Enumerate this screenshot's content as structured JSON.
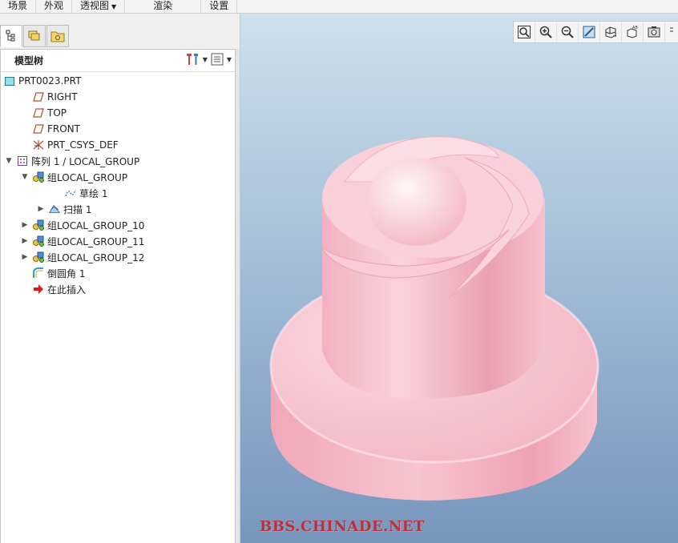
{
  "ribbon": {
    "tabs": [
      {
        "label": "场景",
        "dropdown": false
      },
      {
        "label": "外观",
        "dropdown": false
      },
      {
        "label": "透视图",
        "dropdown": true
      },
      {
        "label": "渲染",
        "dropdown": false
      },
      {
        "label": "设置",
        "dropdown": false
      }
    ]
  },
  "panel": {
    "tabs": [
      "model-tree-icon",
      "layers-icon",
      "folder-icon"
    ],
    "tree_title": "模型树"
  },
  "tree": {
    "root": "PRT0023.PRT",
    "items": [
      {
        "label": "RIGHT",
        "icon": "datum-plane-icon",
        "indent": 1,
        "arrow": ""
      },
      {
        "label": "TOP",
        "icon": "datum-plane-icon",
        "indent": 1,
        "arrow": ""
      },
      {
        "label": "FRONT",
        "icon": "datum-plane-icon",
        "indent": 1,
        "arrow": ""
      },
      {
        "label": "PRT_CSYS_DEF",
        "icon": "csys-icon",
        "indent": 1,
        "arrow": ""
      },
      {
        "label": "阵列 1 / LOCAL_GROUP",
        "icon": "pattern-icon",
        "indent": 0,
        "arrow": "▼"
      },
      {
        "label": "组LOCAL_GROUP",
        "icon": "group-icon",
        "indent": 1,
        "arrow": "▼"
      },
      {
        "label": "草绘 1",
        "icon": "sketch-icon",
        "indent": 3,
        "arrow": ""
      },
      {
        "label": "扫描 1",
        "icon": "sweep-icon",
        "indent": 2,
        "arrow": "▶"
      },
      {
        "label": "组LOCAL_GROUP_10",
        "icon": "group-icon",
        "indent": 1,
        "arrow": "▶"
      },
      {
        "label": "组LOCAL_GROUP_11",
        "icon": "group-icon",
        "indent": 1,
        "arrow": "▶"
      },
      {
        "label": "组LOCAL_GROUP_12",
        "icon": "group-icon",
        "indent": 1,
        "arrow": "▶"
      },
      {
        "label": "倒圆角 1",
        "icon": "round-icon",
        "indent": 1,
        "arrow": ""
      },
      {
        "label": "在此插入",
        "icon": "insert-here-icon",
        "indent": 1,
        "arrow": ""
      }
    ]
  },
  "viewport": {
    "toolbar": [
      "zoom-fit-icon",
      "zoom-in-icon",
      "zoom-out-icon",
      "repaint-icon",
      "display-style-icon",
      "saved-views-icon",
      "view-manager-icon",
      "more-icon"
    ],
    "watermark": "BBS.CHINADE.NET",
    "model_color": "#f2b8c6"
  }
}
